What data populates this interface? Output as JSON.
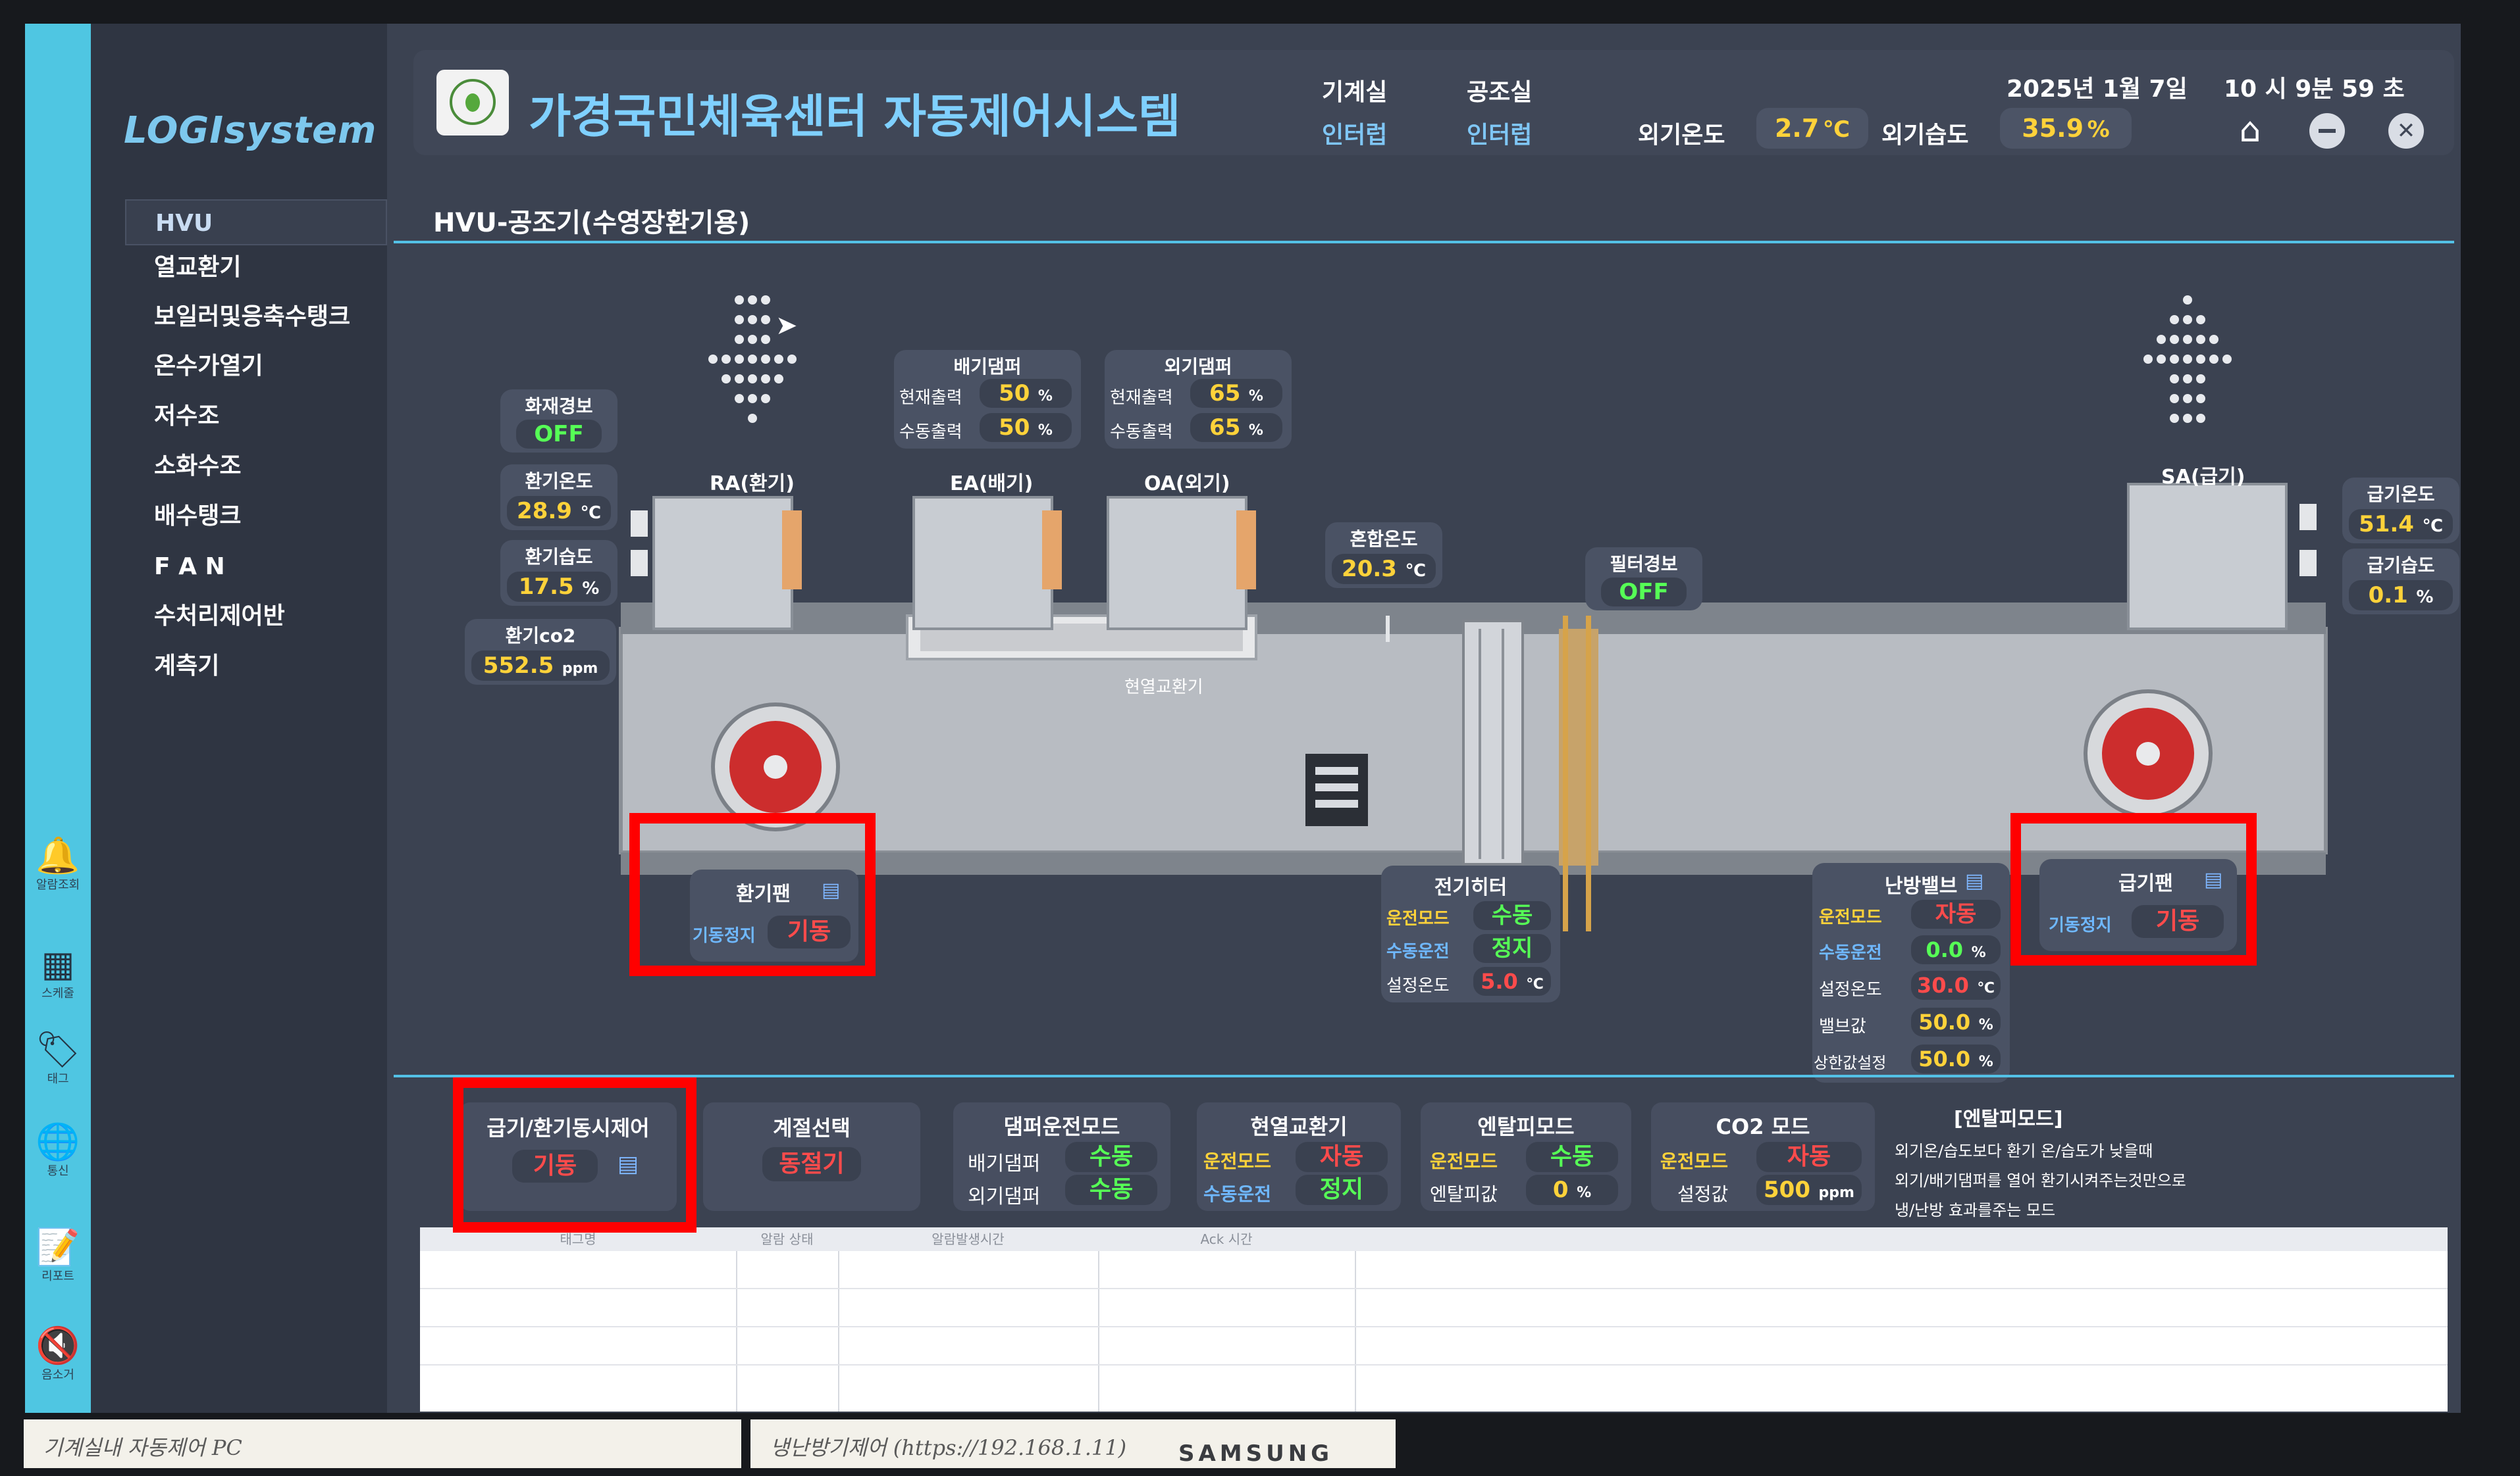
{
  "header": {
    "title": "가경국민체육센터 자동제어시스템",
    "machine_room_label": "기계실",
    "machine_room_value": "인터럽",
    "ahu_room_label": "공조실",
    "ahu_room_value": "인터럽",
    "outdoor_temp_label": "외기온도",
    "outdoor_temp_value": "2.7",
    "outdoor_temp_unit": "℃",
    "outdoor_hum_label": "외기습도",
    "outdoor_hum_value": "35.9",
    "outdoor_hum_unit": "%",
    "date": "2025년  1월  7일",
    "time": "10 시   9분  59 초"
  },
  "logo": "LOGIsystem",
  "sidebar": {
    "items": [
      {
        "label": "HVU"
      },
      {
        "label": "열교환기"
      },
      {
        "label": "보일러및응축수탱크"
      },
      {
        "label": "온수가열기"
      },
      {
        "label": "저수조"
      },
      {
        "label": "소화수조"
      },
      {
        "label": "배수탱크"
      },
      {
        "label": "F A N"
      },
      {
        "label": "수처리제어반"
      },
      {
        "label": "계측기"
      }
    ],
    "tools": [
      {
        "label": "알람조회",
        "icon": "bell-icon"
      },
      {
        "label": "스케줄",
        "icon": "calendar-icon"
      },
      {
        "label": "태그",
        "icon": "tag-icon"
      },
      {
        "label": "통신",
        "icon": "globe-icon"
      },
      {
        "label": "리포트",
        "icon": "report-icon"
      },
      {
        "label": "음소거",
        "icon": "mute-icon"
      }
    ]
  },
  "page": {
    "title": "HVU-공조기(수영장환기용)"
  },
  "diagram": {
    "fire_alarm_label": "화재경보",
    "fire_alarm_value": "OFF",
    "return_temp_label": "환기온도",
    "return_temp_value": "28.9",
    "return_temp_unit": "℃",
    "return_hum_label": "환기습도",
    "return_hum_value": "17.5",
    "return_hum_unit": "%",
    "return_co2_label": "환기co2",
    "return_co2_value": "552.5",
    "return_co2_unit": "ppm",
    "exhaust_damper_title": "배기댐퍼",
    "exhaust_current_label": "현재출력",
    "exhaust_current_value": "50",
    "exhaust_manual_label": "수동출력",
    "exhaust_manual_value": "50",
    "outdoor_damper_title": "외기댐퍼",
    "outdoor_current_label": "현재출력",
    "outdoor_current_value": "65",
    "outdoor_manual_label": "수동출력",
    "outdoor_manual_value": "65",
    "percent": "%",
    "ra_label": "RA(환기)",
    "ea_label": "EA(배기)",
    "oa_label": "OA(외기)",
    "sa_label": "SA(급기)",
    "mix_temp_label": "혼합온도",
    "mix_temp_value": "20.3",
    "mix_temp_unit": "℃",
    "filter_alarm_label": "필터경보",
    "filter_alarm_value": "OFF",
    "hrv_label": "현열교환기",
    "supply_temp_label": "급기온도",
    "supply_temp_value": "51.4",
    "supply_temp_unit": "℃",
    "supply_hum_label": "급기습도",
    "supply_hum_value": "0.1",
    "supply_hum_unit": "%",
    "return_fan_title": "환기팬",
    "return_fan_status_label": "기동정지",
    "return_fan_status_value": "기동",
    "supply_fan_title": "급기팬",
    "supply_fan_status_label": "기동정지",
    "supply_fan_status_value": "기동",
    "heater_title": "전기히터",
    "heater_mode_label": "운전모드",
    "heater_mode_value": "수동",
    "heater_manual_label": "수동운전",
    "heater_manual_value": "정지",
    "heater_set_label": "설정온도",
    "heater_set_value": "5.0",
    "heater_set_unit": "℃",
    "valve_title": "난방밸브",
    "valve_mode_label": "운전모드",
    "valve_mode_value": "자동",
    "valve_manual_label": "수동운전",
    "valve_manual_value": "0.0",
    "valve_set_label": "설정온도",
    "valve_set_value": "30.0",
    "valve_set_unit": "℃",
    "valve_value_label": "밸브값",
    "valve_value_value": "50.0",
    "valve_upper_label": "상한값설정",
    "valve_upper_value": "50.0"
  },
  "controls": {
    "simul_title": "급기/환기동시제어",
    "simul_value": "기동",
    "season_title": "계절선택",
    "season_value": "동절기",
    "damper_mode_title": "댐퍼운전모드",
    "damper_exhaust_label": "배기댐퍼",
    "damper_exhaust_value": "수동",
    "damper_outdoor_label": "외기댐퍼",
    "damper_outdoor_value": "수동",
    "hrv_title": "현열교환기",
    "hrv_mode_label": "운전모드",
    "hrv_mode_value": "자동",
    "hrv_manual_label": "수동운전",
    "hrv_manual_value": "정지",
    "enthalpy_title": "엔탈피모드",
    "enthalpy_mode_label": "운전모드",
    "enthalpy_mode_value": "수동",
    "enthalpy_val_label": "엔탈피값",
    "enthalpy_val_value": "0",
    "co2_title": "CO2 모드",
    "co2_mode_label": "운전모드",
    "co2_mode_value": "자동",
    "co2_set_label": "설정값",
    "co2_set_value": "500",
    "co2_set_unit": "ppm",
    "note_title": "[엔탈피모드]",
    "note_line1": "외기온/습도보다 환기 온/습도가 낮을때",
    "note_line2": "외기/배기댐퍼를 열어 환기시켜주는것만으로",
    "note_line3": "냉/난방 효과를주는 모드"
  },
  "alarm_table": {
    "columns": [
      "태그명",
      "알람 상태",
      "알람발생시간",
      "Ack 시간",
      ""
    ]
  },
  "tape": {
    "left": "기계실내 자동제어 PC",
    "right": "냉난방기제어 (https://192.168.1.11)"
  },
  "bezel_brand": "SAMSUNG",
  "colors": {
    "accent_blue": "#7fd0ff",
    "value_yellow": "#ffd23a",
    "state_green": "#56ff56",
    "state_red": "#ff4b4b",
    "highlight_box": "#ff0000"
  }
}
